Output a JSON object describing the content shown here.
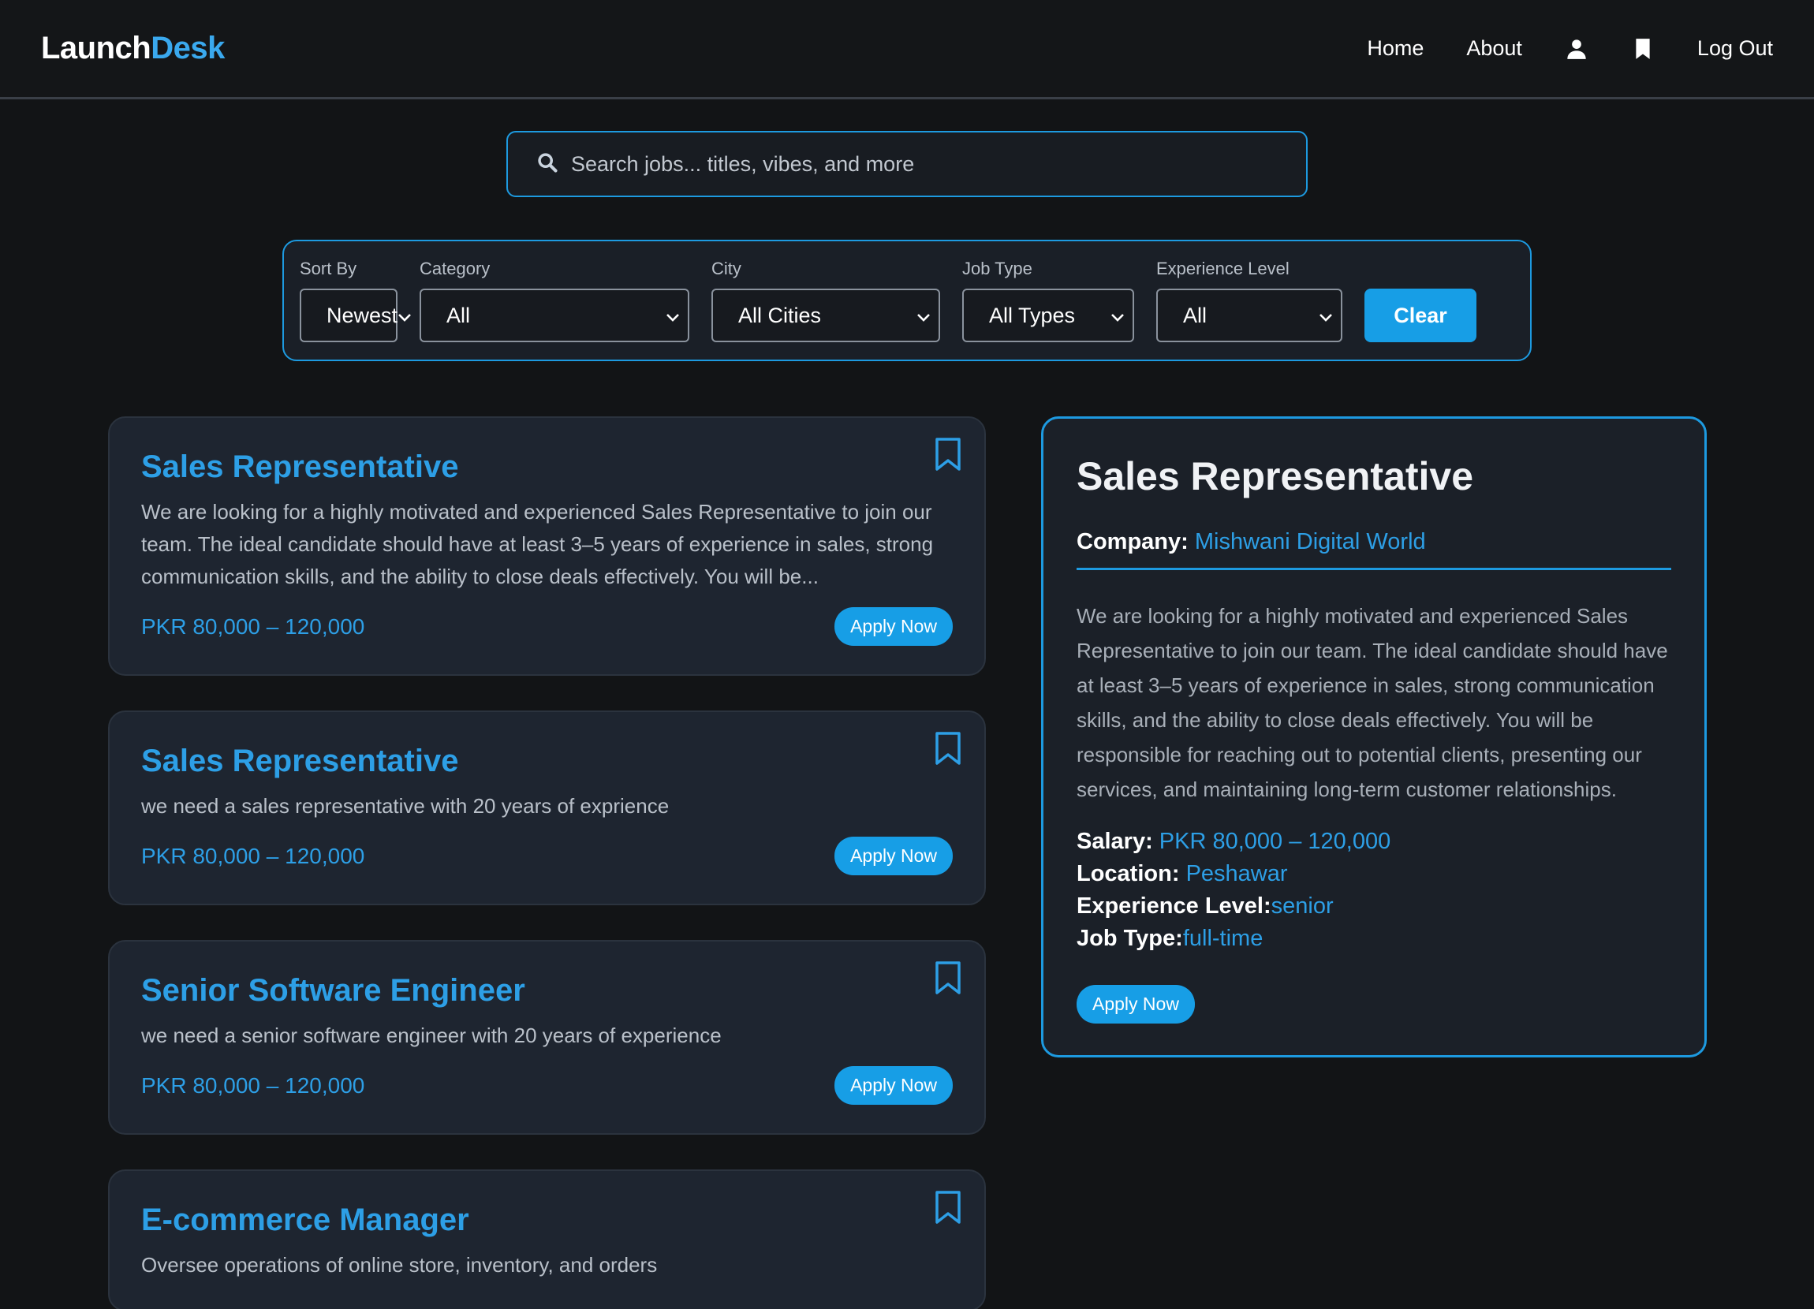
{
  "brand": {
    "part1": "Launch",
    "part2": "Desk"
  },
  "nav": {
    "home": "Home",
    "about": "About",
    "logout": "Log Out"
  },
  "search": {
    "placeholder": "Search jobs... titles, vibes, and more"
  },
  "filters": {
    "sort_label": "Sort By",
    "sort_value": "Newest",
    "category_label": "Category",
    "category_value": "All",
    "city_label": "City",
    "city_value": "All Cities",
    "jobtype_label": "Job Type",
    "jobtype_value": "All Types",
    "experience_label": "Experience Level",
    "experience_value": "All",
    "clear_label": "Clear"
  },
  "jobs": [
    {
      "title": "Sales Representative",
      "desc": "We are looking for a highly motivated and experienced Sales Representative to join our team. The ideal candidate should have at least 3–5 years of experience in sales, strong communication skills, and the ability to close deals effectively. You will be...",
      "salary": "PKR 80,000 – 120,000",
      "apply": "Apply Now"
    },
    {
      "title": "Sales Representative",
      "desc": "we need a sales representative with 20 years of exprience",
      "salary": "PKR 80,000 – 120,000",
      "apply": "Apply Now"
    },
    {
      "title": "Senior Software Engineer",
      "desc": "we need a senior software engineer with 20 years of experience",
      "salary": "PKR 80,000 – 120,000",
      "apply": "Apply Now"
    },
    {
      "title": "E-commerce Manager",
      "desc": "Oversee operations of online store, inventory, and orders",
      "salary": "",
      "apply": ""
    }
  ],
  "detail": {
    "title": "Sales Representative",
    "company_label": "Company:",
    "company": "Mishwani Digital World",
    "desc": "We are looking for a highly motivated and experienced Sales Representative to join our team. The ideal candidate should have at least 3–5 years of experience in sales, strong communication skills, and the ability to close deals effectively. You will be responsible for reaching out to potential clients, presenting our services, and maintaining long-term customer relationships.",
    "salary_label": "Salary:",
    "salary": "PKR 80,000 – 120,000",
    "location_label": "Location:",
    "location": "Peshawar",
    "experience_label": "Experience Level:",
    "experience": "senior",
    "jobtype_label": "Job Type:",
    "jobtype": "full-time",
    "apply": "Apply Now"
  },
  "colors": {
    "accent": "#1d9ae0",
    "background": "#121416",
    "card": "#1e2530"
  }
}
